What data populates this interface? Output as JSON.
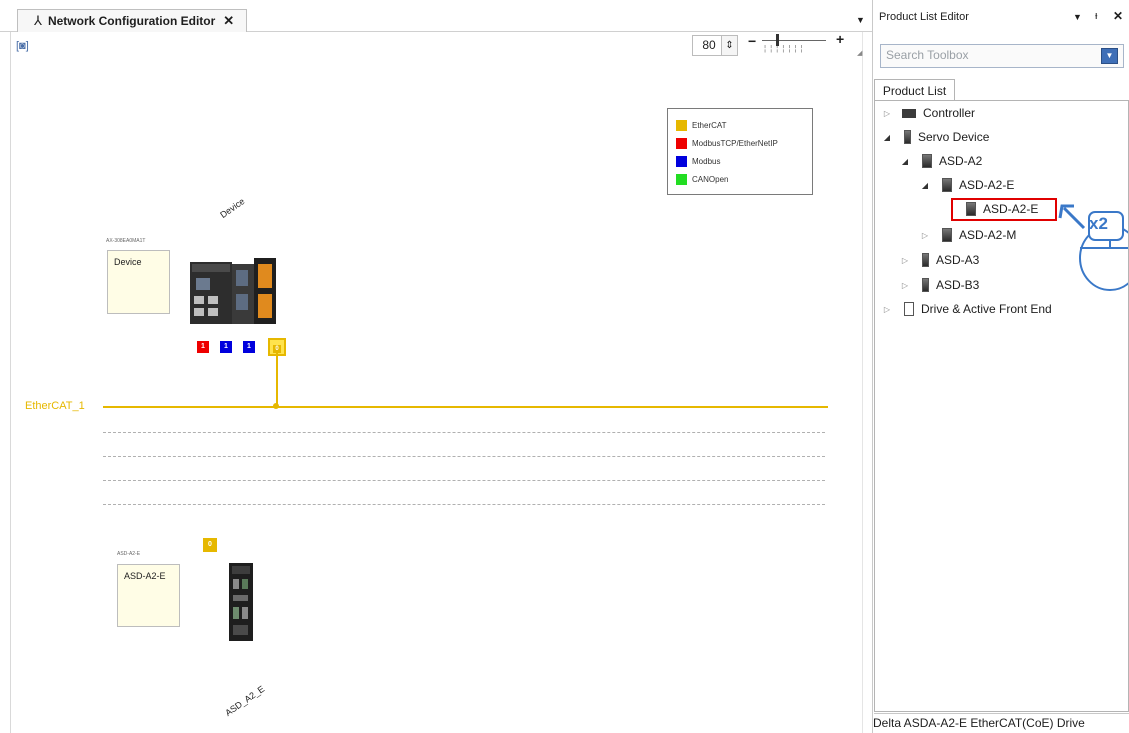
{
  "editor": {
    "tab_label": "Network Configuration Editor",
    "tab_close": "✕",
    "zoom_value": "80",
    "legend": [
      {
        "label": "EtherCAT",
        "color": "#e6b800"
      },
      {
        "label": "ModbusTCP/EtherNetIP",
        "color": "#ee0000"
      },
      {
        "label": "Modbus",
        "color": "#0000dd"
      },
      {
        "label": "CANOpen",
        "color": "#22dd22"
      }
    ],
    "controller": {
      "model": "AX-308EA0MA1T",
      "name": "Device",
      "rotated_label": "Device",
      "ports": [
        {
          "label": "1",
          "color": "#ee0000"
        },
        {
          "label": "1",
          "color": "#0000dd"
        },
        {
          "label": "1",
          "color": "#0000dd"
        },
        {
          "label": "0",
          "color": "#e6b800"
        }
      ]
    },
    "bus": {
      "label": "EtherCAT_1",
      "color": "#e6b800"
    },
    "drive": {
      "model": "ASD-A2-E",
      "name": "ASD-A2-E",
      "rotated_label": "ASD_A2_E",
      "port_label": "0"
    }
  },
  "panel": {
    "title": "Product List Editor",
    "search_placeholder": "Search Toolbox",
    "tab_label": "Product List",
    "tree": [
      {
        "label": "Controller",
        "expanded": false,
        "icon": "controller-icon"
      },
      {
        "label": "Servo Device",
        "expanded": true,
        "icon": "servo-icon"
      },
      {
        "label": "ASD-A2",
        "expanded": true,
        "icon": "servo-icon"
      },
      {
        "label": "ASD-A2-E",
        "expanded": true,
        "icon": "servo-icon"
      },
      {
        "label": "ASD-A2-E",
        "expanded": null,
        "icon": "servo-icon",
        "selected": true
      },
      {
        "label": "ASD-A2-M",
        "expanded": false,
        "icon": "servo-icon"
      },
      {
        "label": "ASD-A3",
        "expanded": false,
        "icon": "servo-icon"
      },
      {
        "label": "ASD-B3",
        "expanded": false,
        "icon": "servo-icon"
      },
      {
        "label": "Drive & Active Front End",
        "expanded": false,
        "icon": "drive-icon"
      }
    ],
    "annotation": "x2",
    "status": "Delta ASDA-A2-E EtherCAT(CoE) Drive"
  }
}
